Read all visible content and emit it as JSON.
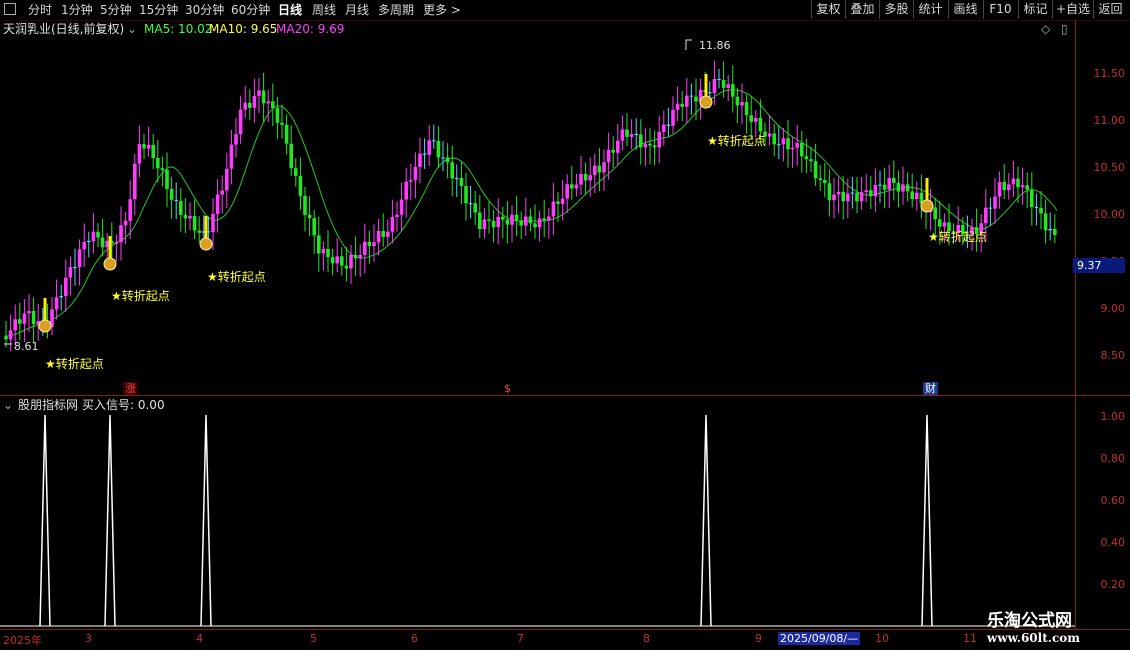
{
  "toolbar": {
    "periods": [
      "分时",
      "1分钟",
      "5分钟",
      "15分钟",
      "30分钟",
      "60分钟",
      "日线",
      "周线",
      "月线",
      "多周期",
      "更多 >"
    ],
    "active_period": "日线",
    "right_buttons": [
      "复权",
      "叠加",
      "多股",
      "统计",
      "画线",
      "F10",
      "标记",
      "+自选",
      "返回"
    ]
  },
  "main_pane": {
    "title": "天润乳业(日线,前复权)",
    "ma5_label": "MA5: 10.02",
    "ma10_label": "MA10: 9.65",
    "ma20_label": "MA20: 9.69",
    "high_label": "11.86",
    "low_label": "8.61",
    "current_price": "9.37",
    "signal_text": "★转折起点",
    "badges": {
      "zhang": "涨",
      "dollar": "$",
      "cai": "财"
    },
    "price_ticks": [
      "11.50",
      "11.00",
      "10.50",
      "10.00",
      "9.50",
      "9.00",
      "8.50"
    ]
  },
  "sub_pane": {
    "title": "股朋指标网",
    "signal_label": "买入信号: 0.00",
    "ticks": [
      "1.00",
      "0.80",
      "0.60",
      "0.40",
      "0.20"
    ]
  },
  "time_axis": {
    "labels": [
      "2025年",
      "3",
      "4",
      "5",
      "6",
      "7",
      "8",
      "9",
      "10",
      "11"
    ],
    "selected_date": "2025/09/08/—"
  },
  "watermark": {
    "line1": "乐淘公式网",
    "line2": "www.60lt.com"
  },
  "colors": {
    "up": "#ff3bff",
    "down": "#22e622",
    "doji": "#5ad8ff",
    "ma5": "#ffffff",
    "ma20": "#22c822",
    "axis": "#c03030"
  }
}
